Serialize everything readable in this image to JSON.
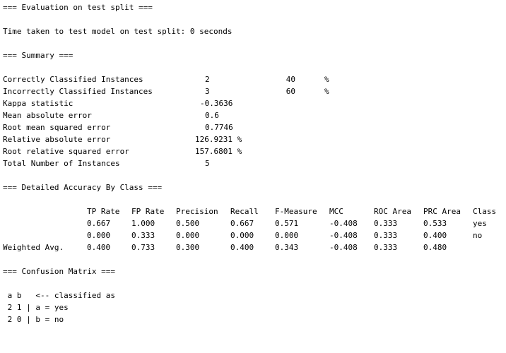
{
  "evaluation": {
    "header": "=== Evaluation on test split ===",
    "time_line": "Time taken to test model on test split: 0 seconds"
  },
  "summary": {
    "header": "=== Summary ===",
    "rows": [
      {
        "label": "Correctly Classified Instances",
        "value": "2",
        "percent": "40",
        "unit": "%"
      },
      {
        "label": "Incorrectly Classified Instances",
        "value": "3",
        "percent": "60",
        "unit": "%"
      },
      {
        "label": "Kappa statistic",
        "value": "-0.3636"
      },
      {
        "label": "Mean absolute error",
        "value": "0.6"
      },
      {
        "label": "Root mean squared error",
        "value": "0.7746"
      },
      {
        "label": "Relative absolute error",
        "value": "126.9231 %"
      },
      {
        "label": "Root relative squared error",
        "value": "157.6801 %"
      },
      {
        "label": "Total Number of Instances",
        "value": "5"
      }
    ]
  },
  "accuracy": {
    "header": "=== Detailed Accuracy By Class ===",
    "columns": [
      "TP Rate",
      "FP Rate",
      "Precision",
      "Recall",
      "F-Measure",
      "MCC",
      "ROC Area",
      "PRC Area",
      "Class"
    ],
    "rows": [
      {
        "label": "",
        "cells": [
          "0.667",
          "1.000",
          "0.500",
          "0.667",
          "0.571",
          "-0.408",
          "0.333",
          "0.533",
          "yes"
        ]
      },
      {
        "label": "",
        "cells": [
          "0.000",
          "0.333",
          "0.000",
          "0.000",
          "0.000",
          "-0.408",
          "0.333",
          "0.400",
          "no"
        ]
      },
      {
        "label": "Weighted Avg.",
        "cells": [
          "0.400",
          "0.733",
          "0.300",
          "0.400",
          "0.343",
          "-0.408",
          "0.333",
          "0.480",
          ""
        ]
      }
    ]
  },
  "confusion": {
    "header": "=== Confusion Matrix ===",
    "lines": [
      " a b   <-- classified as",
      " 2 1 | a = yes",
      " 2 0 | b = no"
    ]
  }
}
